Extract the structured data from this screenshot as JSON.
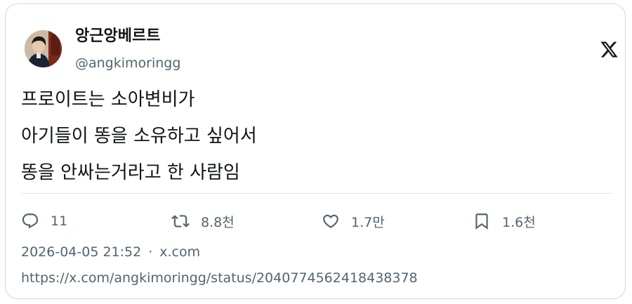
{
  "author": {
    "display_name": "앙근앙베르트",
    "handle": "@angkimoringg"
  },
  "brand_icon": "x-logo-icon",
  "tweet": {
    "lines": [
      "프로이트는 소아변비가",
      "아기들이 똥을 소유하고 싶어서",
      "똥을 안싸는거라고 한 사람임"
    ]
  },
  "actions": {
    "reply": {
      "icon": "reply-icon",
      "count": "11"
    },
    "retweet": {
      "icon": "retweet-icon",
      "count": "8.8천"
    },
    "like": {
      "icon": "heart-icon",
      "count": "1.7만"
    },
    "bookmark": {
      "icon": "bookmark-icon",
      "count": "1.6천"
    }
  },
  "meta": {
    "timestamp": "2026-04-05 21:52",
    "separator": "·",
    "source": "x.com"
  },
  "status_url": "https://x.com/angkimoringg/status/2040774562418438378",
  "colors": {
    "text": "#0f1419",
    "muted": "#536471",
    "border": "#cfd9de"
  }
}
